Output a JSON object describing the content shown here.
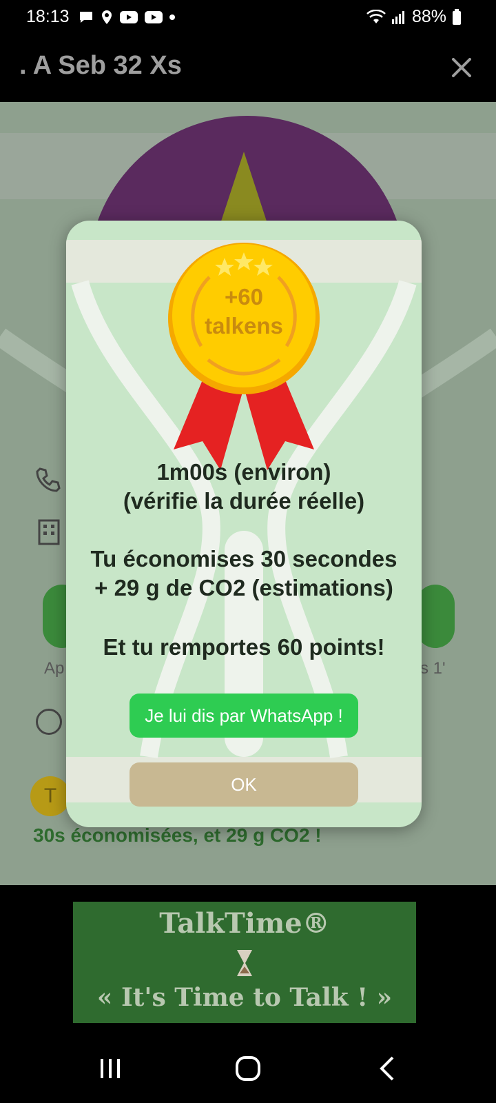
{
  "status_bar": {
    "time": "18:13",
    "battery": "88%"
  },
  "app_bar": {
    "title": ". A Seb 32 Xs"
  },
  "background": {
    "left_label": "Ap",
    "right_label": "s 1'",
    "saved_text": "30s économisées, et 29 g CO2 !"
  },
  "modal": {
    "medal_line1": "+60",
    "medal_line2": "talkens",
    "duration": "1m00s (environ)",
    "check_note": "(vérifie la durée réelle)",
    "savings_line1": "Tu économises 30 secondes",
    "savings_line2": "+ 29 g de CO2 (estimations)",
    "points_line": "Et tu remportes 60 points!",
    "whatsapp_button": "Je lui dis par WhatsApp !",
    "ok_button": "OK"
  },
  "banner": {
    "title": "TalkTime®",
    "tagline": "« It's Time to Talk  ! »"
  },
  "colors": {
    "whatsapp_green": "#2ecc52",
    "ok_tan": "#c8b892",
    "modal_bg": "#c8e6c8",
    "medal_gold": "#ffcc00",
    "ribbon_red": "#e52222"
  }
}
